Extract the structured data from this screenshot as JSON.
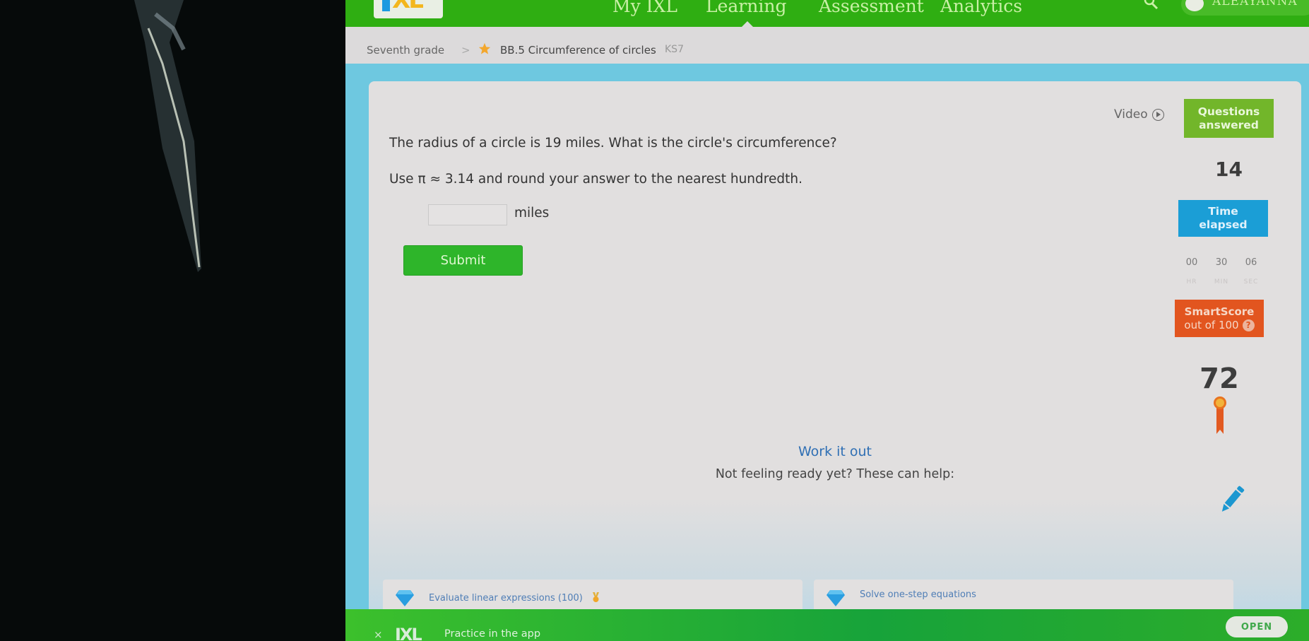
{
  "nav": {
    "logo": "IXL",
    "links": [
      "My IXL",
      "Learning",
      "Assessment",
      "Analytics"
    ],
    "active_link": "Learning",
    "user_name": "ALEAYANNA"
  },
  "breadcrumb": {
    "grade": "Seventh grade",
    "separator": ">",
    "skill": "BB.5 Circumference of circles",
    "code": "KS7"
  },
  "question": {
    "prompt": "The radius of a circle is 19 miles. What is the circle's circumference?",
    "instruction": "Use π ≈ 3.14 and round your answer to the nearest hundredth.",
    "answer_value": "",
    "units": "miles",
    "submit_label": "Submit"
  },
  "sidebar": {
    "video_label": "Video",
    "questions_answered_label": [
      "Questions",
      "answered"
    ],
    "questions_answered": "14",
    "time_elapsed_label": [
      "Time",
      "elapsed"
    ],
    "timer": [
      {
        "value": "00",
        "unit": "HR"
      },
      {
        "value": "30",
        "unit": "MIN"
      },
      {
        "value": "06",
        "unit": "SEC"
      }
    ],
    "smartscore_label": "SmartScore",
    "smartscore_sub": "out of 100",
    "smartscore_help": "?",
    "smartscore": "72"
  },
  "help": {
    "work_it_out": "Work it out",
    "not_ready": "Not feeling ready yet? These can help:",
    "suggestions": [
      {
        "label": "Evaluate linear expressions (100)",
        "has_medal": true
      },
      {
        "label": "Solve one-step equations",
        "has_medal": false
      }
    ]
  },
  "app_banner": {
    "close": "×",
    "logo": "IXL",
    "text": "Practice in the app",
    "open_label": "OPEN"
  },
  "colors": {
    "nav_green": "#2fae12",
    "qa_green": "#72b62a",
    "time_blue": "#1b9ed6",
    "smartscore_orange": "#e2551f",
    "submit_green": "#2eb52a",
    "link_blue": "#2f6fb4"
  }
}
